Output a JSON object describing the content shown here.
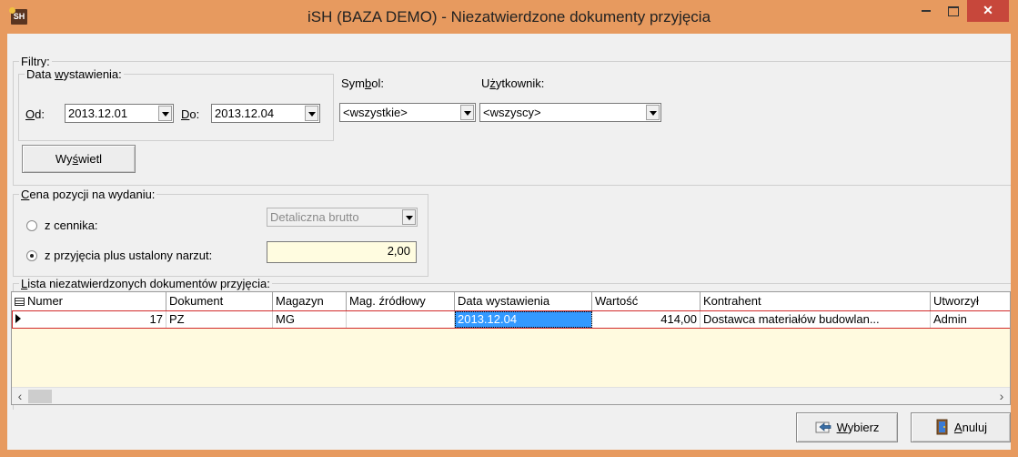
{
  "window": {
    "title": "iSH (BAZA DEMO) - Niezatwierdzone dokumenty przyjęcia",
    "app_icon_text": "SH",
    "frame_color": "#E79A5F",
    "close_color": "#C7473B"
  },
  "filters": {
    "legend": "Filtry:",
    "date_group": {
      "legend_pre": "Data ",
      "legend_u": "w",
      "legend_post": "ystawienia:",
      "from_u": "O",
      "from_post": "d:",
      "from_value": "2013.12.01",
      "to_u": "D",
      "to_post": "o:",
      "to_value": "2013.12.04"
    },
    "symbol": {
      "pre": "Sym",
      "u": "b",
      "post": "ol:",
      "value": "<wszystkie>"
    },
    "user": {
      "pre": "U",
      "u": "ż",
      "post": "ytkownik:",
      "value": "<wszyscy>"
    },
    "show_button": {
      "pre": "Wy",
      "u": "ś",
      "post": "wietl"
    }
  },
  "price": {
    "legend_u": "C",
    "legend_post": "ena pozycji na wydaniu:",
    "option1": "z cennika:",
    "option1_select": "Detaliczna brutto",
    "option2": "z przyjęcia plus ustalony narzut:",
    "markup_value": "2,00",
    "selected": "option2"
  },
  "list": {
    "legend_u": "L",
    "legend_post": "ista niezatwierdzonych dokumentów przyjęcia:",
    "columns": [
      "Numer",
      "Dokument",
      "Magazyn",
      "Mag. źródłowy",
      "Data wystawienia",
      "Wartość",
      "Kontrahent",
      "Utworzył"
    ],
    "rows": [
      {
        "numer": "17",
        "dokument": "PZ",
        "magazyn": "MG",
        "mag_zrodlowy": "",
        "data": "2013.12.04",
        "wartosc": "414,00",
        "kontrahent": "Dostawca materiałów budowlan...",
        "utworzyl": "Admin"
      }
    ]
  },
  "buttons": {
    "select": {
      "u": "W",
      "post": "ybierz"
    },
    "cancel": {
      "u": "A",
      "post": "nuluj"
    }
  }
}
